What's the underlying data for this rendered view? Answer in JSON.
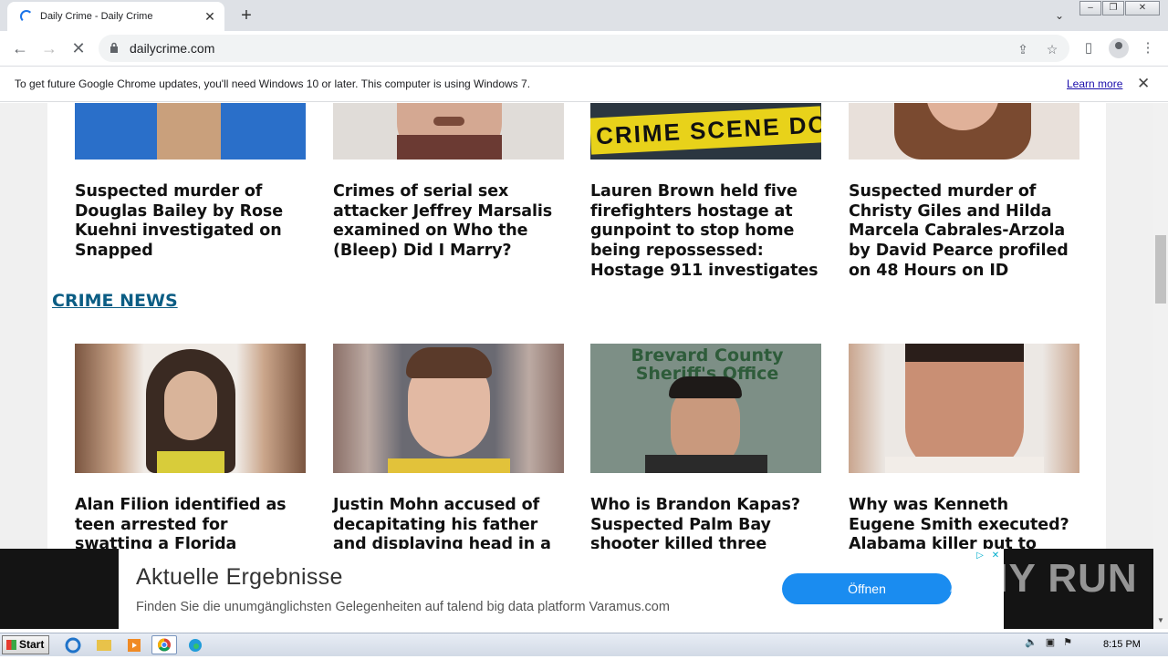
{
  "browser": {
    "tab_title": "Daily Crime - Daily Crime",
    "url": "dailycrime.com",
    "infobar_message": "To get future Google Chrome updates, you'll need Windows 10 or later. This computer is using Windows 7.",
    "infobar_link": "Learn more"
  },
  "page": {
    "top_articles": [
      {
        "headline": "Suspected murder of Douglas Bailey by Rose Kuehni investigated on Snapped"
      },
      {
        "headline": "Crimes of serial sex attacker Jeffrey Marsalis examined on Who the (Bleep) Did I Marry?"
      },
      {
        "headline": "Lauren Brown held five firefighters hostage at gunpoint to stop home being repossessed: Hostage 911 investigates"
      },
      {
        "headline": "Suspected murder of Christy Giles and Hilda Marcela Cabrales-Arzola by David Pearce profiled on 48 Hours on ID"
      }
    ],
    "section_title": "CRIME NEWS",
    "news_articles": [
      {
        "headline": "Alan Filion identified as teen arrested for swatting a Florida mosque: Threa... in 'th..."
      },
      {
        "headline": "Justin Mohn accused of decapitating his father and displaying head in a"
      },
      {
        "headline": "Who is Brandon Kapas? Suspected Palm Bay shooter killed three people"
      },
      {
        "headline": "Why was Kenneth Eugene Smith executed? Alabama killer put to death using ...hat was"
      }
    ],
    "thumb_text": {
      "tape": "CRIME SCENE DO NOT",
      "sheriff_line1": "Brevard County",
      "sheriff_line2": "Sheriff's Office"
    }
  },
  "ad": {
    "title": "Aktuelle Ergebnisse",
    "description": "Finden Sie die unumgänglichsten Gelegenheiten auf talend big data platform Varamus.com",
    "cta": "Öffnen",
    "watermark": "ANY RUN"
  },
  "taskbar": {
    "start_label": "Start",
    "clock": "8:15 PM"
  },
  "colors": {
    "section_link": "#0b5d84",
    "cta": "#1a8cf0"
  }
}
